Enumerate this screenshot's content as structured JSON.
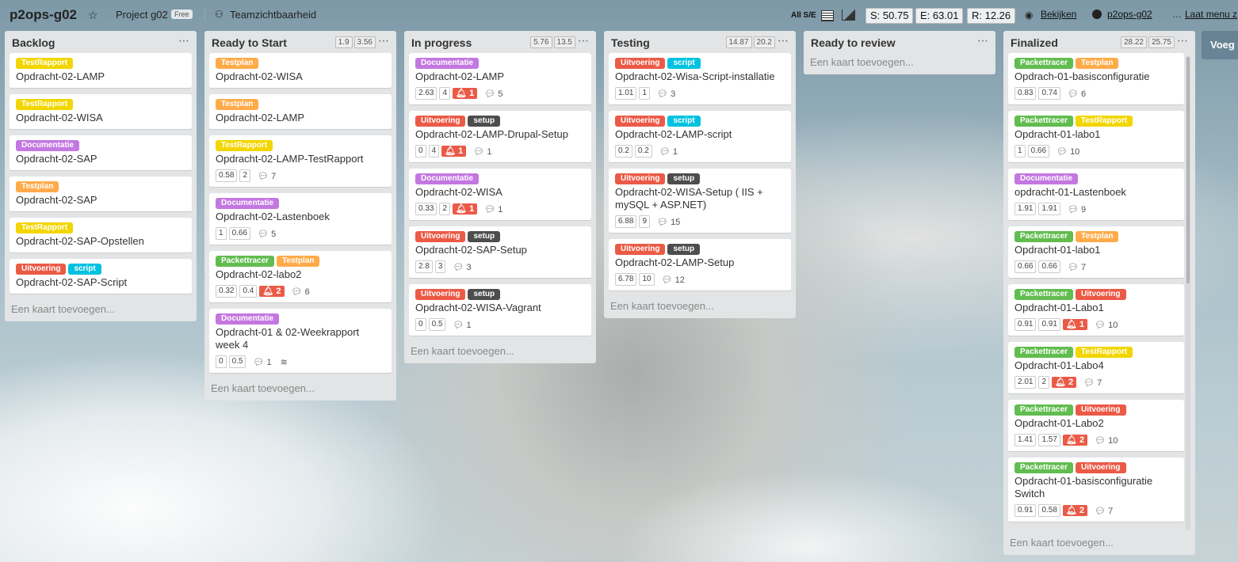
{
  "colors": {
    "TestRapport": "#f2d600",
    "Documentatie": "#c377e0",
    "Testplan": "#ffab4a",
    "Uitvoering": "#eb5a46",
    "script": "#00c2e0",
    "setup": "#4d4d4d",
    "Packettracer": "#61bd4f"
  },
  "header": {
    "board_title": "p2ops-g02",
    "star_icon": "star-icon",
    "team": "Project g02",
    "plan_badge": "Free",
    "visibility": "Teamzichtbaarheid",
    "all_se": "All S/E",
    "stat_s": "S: 50.75",
    "stat_e": "E: 63.01",
    "stat_r": "R: 12.26",
    "view_link": "Bekijken",
    "github_link": "p2ops-g02",
    "menu_link": "Laat menu z"
  },
  "add_list": "Voeg e",
  "add_card_text": "Een kaart toevoegen...",
  "lists": [
    {
      "title": "Backlog",
      "stats": [],
      "cards": [
        {
          "labels": [
            "TestRapport"
          ],
          "title": "Opdracht-02-LAMP",
          "badges": []
        },
        {
          "labels": [
            "TestRapport"
          ],
          "title": "Opdracht-02-WISA",
          "badges": []
        },
        {
          "labels": [
            "Documentatie"
          ],
          "title": "Opdracht-02-SAP",
          "badges": []
        },
        {
          "labels": [
            "Testplan"
          ],
          "title": "Opdracht-02-SAP",
          "badges": []
        },
        {
          "labels": [
            "TestRapport"
          ],
          "title": "Opdracht-02-SAP-Opstellen",
          "badges": []
        },
        {
          "labels": [
            "Uitvoering",
            "script"
          ],
          "title": "Opdracht-02-SAP-Script",
          "badges": []
        }
      ]
    },
    {
      "title": "Ready to Start",
      "stats": [
        "1.9",
        "3.56"
      ],
      "cards": [
        {
          "labels": [
            "Testplan"
          ],
          "title": "Opdracht-02-WISA",
          "badges": []
        },
        {
          "labels": [
            "Testplan"
          ],
          "title": "Opdracht-02-LAMP",
          "badges": []
        },
        {
          "labels": [
            "TestRapport"
          ],
          "title": "Opdracht-02-LAMP-TestRapport",
          "badges": [
            "0.58",
            "2"
          ],
          "due": "",
          "comments": "7"
        },
        {
          "labels": [
            "Documentatie"
          ],
          "title": "Opdracht-02-Lastenboek",
          "badges": [
            "1",
            "0.66"
          ],
          "due": "",
          "comments": "5"
        },
        {
          "labels": [
            "Packettracer",
            "Testplan"
          ],
          "title": "Opdracht-02-labo2",
          "badges": [
            "0.32",
            "0.4"
          ],
          "due": "2",
          "comments": "6"
        },
        {
          "labels": [
            "Documentatie"
          ],
          "title": "Opdracht-01 & 02-Weekrapport week 4",
          "badges": [
            "0",
            "0.5"
          ],
          "due": "",
          "comments": "1",
          "checklist": true
        }
      ]
    },
    {
      "title": "In progress",
      "stats": [
        "5.76",
        "13.5"
      ],
      "cards": [
        {
          "labels": [
            "Documentatie"
          ],
          "title": "Opdracht-02-LAMP",
          "badges": [
            "2.63",
            "4"
          ],
          "due": "1",
          "comments": "5"
        },
        {
          "labels": [
            "Uitvoering",
            "setup"
          ],
          "title": "Opdracht-02-LAMP-Drupal-Setup",
          "badges": [
            "0",
            "4"
          ],
          "due": "1",
          "comments": "1"
        },
        {
          "labels": [
            "Documentatie"
          ],
          "title": "Opdracht-02-WISA",
          "badges": [
            "0.33",
            "2"
          ],
          "due": "1",
          "comments": "1"
        },
        {
          "labels": [
            "Uitvoering",
            "setup"
          ],
          "title": "Opdracht-02-SAP-Setup",
          "badges": [
            "2.8",
            "3"
          ],
          "due": "",
          "comments": "3"
        },
        {
          "labels": [
            "Uitvoering",
            "setup"
          ],
          "title": "Opdracht-02-WISA-Vagrant",
          "badges": [
            "0",
            "0.5"
          ],
          "due": "",
          "comments": "1"
        }
      ]
    },
    {
      "title": "Testing",
      "stats": [
        "14.87",
        "20.2"
      ],
      "cards": [
        {
          "labels": [
            "Uitvoering",
            "script"
          ],
          "title": "Opdracht-02-Wisa-Script-installatie",
          "badges": [
            "1.01",
            "1"
          ],
          "due": "",
          "comments": "3"
        },
        {
          "labels": [
            "Uitvoering",
            "script"
          ],
          "title": "Opdracht-02-LAMP-script",
          "badges": [
            "0.2",
            "0.2"
          ],
          "due": "",
          "comments": "1"
        },
        {
          "labels": [
            "Uitvoering",
            "setup"
          ],
          "title": "Opdracht-02-WISA-Setup ( IIS + mySQL + ASP.NET)",
          "badges": [
            "6.88",
            "9"
          ],
          "due": "",
          "comments": "15"
        },
        {
          "labels": [
            "Uitvoering",
            "setup"
          ],
          "title": "Opdracht-02-LAMP-Setup",
          "badges": [
            "6.78",
            "10"
          ],
          "due": "",
          "comments": "12"
        }
      ]
    },
    {
      "title": "Ready to review",
      "stats": [],
      "cards": []
    },
    {
      "title": "Finalized",
      "stats": [
        "28.22",
        "25.75"
      ],
      "cards": [
        {
          "labels": [
            "Packettracer",
            "Testplan"
          ],
          "title": "Opdrach-01-basisconfiguratie",
          "badges": [
            "0.83",
            "0.74"
          ],
          "due": "",
          "comments": "6"
        },
        {
          "labels": [
            "Packettracer",
            "TestRapport"
          ],
          "title": "Opdracht-01-labo1",
          "badges": [
            "1",
            "0.66"
          ],
          "due": "",
          "comments": "10"
        },
        {
          "labels": [
            "Documentatie"
          ],
          "title": "opdracht-01-Lastenboek",
          "badges": [
            "1.91",
            "1.91"
          ],
          "due": "",
          "comments": "9"
        },
        {
          "labels": [
            "Packettracer",
            "Testplan"
          ],
          "title": "Opdracht-01-labo1",
          "badges": [
            "0.66",
            "0.66"
          ],
          "due": "",
          "comments": "7"
        },
        {
          "labels": [
            "Packettracer",
            "Uitvoering"
          ],
          "title": "Opdracht-01-Labo1",
          "badges": [
            "0.91",
            "0.91"
          ],
          "due": "1",
          "comments": "10"
        },
        {
          "labels": [
            "Packettracer",
            "TestRapport"
          ],
          "title": "Opdracht-01-Labo4",
          "badges": [
            "2.01",
            "2"
          ],
          "due": "2",
          "comments": "7"
        },
        {
          "labels": [
            "Packettracer",
            "Uitvoering"
          ],
          "title": "Opdracht-01-Labo2",
          "badges": [
            "1.41",
            "1.57"
          ],
          "due": "2",
          "comments": "10"
        },
        {
          "labels": [
            "Packettracer",
            "Uitvoering"
          ],
          "title": "Opdracht-01-basisconfiguratie Switch",
          "badges": [
            "0.91",
            "0.58"
          ],
          "due": "2",
          "comments": "7"
        }
      ]
    }
  ]
}
